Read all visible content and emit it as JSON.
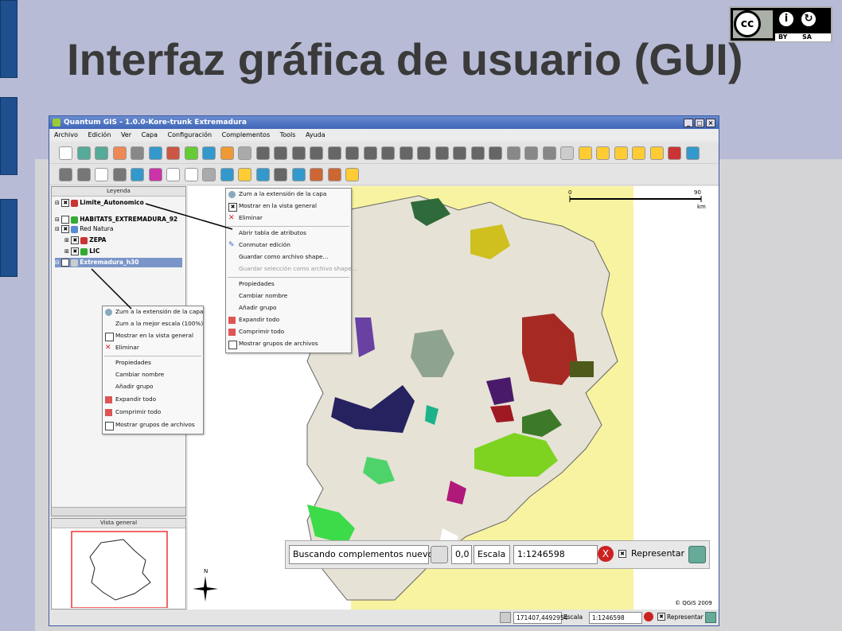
{
  "slide": {
    "title": "Interfaz gráfica de usuario (GUI)",
    "license_badge": {
      "cc": "cc",
      "by": "BY",
      "sa": "SA"
    }
  },
  "window": {
    "title": "Quantum GIS - 1.0.0-Kore-trunk  Extremadura",
    "buttons": [
      "_",
      "□",
      "×"
    ]
  },
  "menu": [
    "Archivo",
    "Edición",
    "Ver",
    "Capa",
    "Configuración",
    "Complementos",
    "Tools",
    "Ayuda"
  ],
  "legend": {
    "header": "Leyenda",
    "layers": [
      {
        "name": "Limite_Autonomico",
        "bold": true,
        "checked": true,
        "expanded": true
      },
      {
        "name": "HABITATS_EXTREMADURA_92",
        "bold": true,
        "checked": false,
        "expanded": true
      },
      {
        "name": "Red Natura",
        "bold": false,
        "checked": true,
        "expanded": true,
        "group": true
      },
      {
        "name": "ZEPA",
        "bold": true,
        "checked": true,
        "expanded": false,
        "child": true
      },
      {
        "name": "LIC",
        "bold": true,
        "checked": true,
        "expanded": false,
        "child": true
      },
      {
        "name": "Extremadura_h30",
        "bold": true,
        "checked": true,
        "expanded": true,
        "selected": true
      }
    ]
  },
  "overview": {
    "header": "Vista general"
  },
  "map": {
    "scalebar": {
      "zero": "0",
      "max": "90",
      "unit": "km"
    },
    "north": "N",
    "copyright": "© QGIS 2009"
  },
  "context_menu_layer": {
    "items": [
      {
        "label": "Zum a la extensión de la capa",
        "icon": "zoom-layer-icon"
      },
      {
        "label": "Mostrar en la vista general",
        "icon": "checkbox-checked-icon"
      },
      {
        "label": "Eliminar",
        "icon": "delete-icon"
      },
      {
        "sep": true
      },
      {
        "label": "Abrir tabla de atributos",
        "icon": ""
      },
      {
        "label": "Conmutar edición",
        "icon": "pencil-icon"
      },
      {
        "label": "Guardar como archivo shape...",
        "icon": ""
      },
      {
        "label": "Guardar selección como archivo shape...",
        "icon": "",
        "disabled": true
      },
      {
        "sep": true
      },
      {
        "label": "Propiedades",
        "icon": ""
      },
      {
        "label": "Cambiar nombre",
        "icon": ""
      },
      {
        "label": "Añadir grupo",
        "icon": ""
      },
      {
        "label": "Expandir todo",
        "icon": "expand-icon"
      },
      {
        "label": "Comprimir todo",
        "icon": "collapse-icon"
      },
      {
        "label": "Mostrar grupos de archivos",
        "icon": "checkbox-empty-icon"
      }
    ]
  },
  "context_menu_raster": {
    "items": [
      {
        "label": "Zum a la extensión de la capa",
        "icon": "zoom-layer-icon"
      },
      {
        "label": "Zum a la mejor escala (100%)",
        "icon": ""
      },
      {
        "label": "Mostrar en la vista general",
        "icon": "checkbox-empty-icon"
      },
      {
        "label": "Eliminar",
        "icon": "delete-icon"
      },
      {
        "sep": true
      },
      {
        "label": "Propiedades",
        "icon": ""
      },
      {
        "label": "Cambiar nombre",
        "icon": ""
      },
      {
        "label": "Añadir grupo",
        "icon": ""
      },
      {
        "label": "Expandir todo",
        "icon": "expand-icon"
      },
      {
        "label": "Comprimir todo",
        "icon": "collapse-icon"
      },
      {
        "label": "Mostrar grupos de archivos",
        "icon": "checkbox-empty-icon"
      }
    ]
  },
  "statusbar": {
    "coords": "171407,4492954",
    "scale_label": "Escala",
    "scale_value": "1:1246598",
    "render_label": "Representar"
  },
  "status_zoom": {
    "message": "Buscando complementos nuevos...",
    "coords": "0,0",
    "scale_label": "Escala",
    "scale_value": "1:1246598",
    "render_label": "Representar"
  },
  "colors": {
    "slide_bg": "#b7bbd6",
    "slide_bar": "#1f4f8e",
    "titlebar": "#3e66b8",
    "map_outside": "#f7f3a0",
    "selected_layer": "#7a96c8"
  }
}
